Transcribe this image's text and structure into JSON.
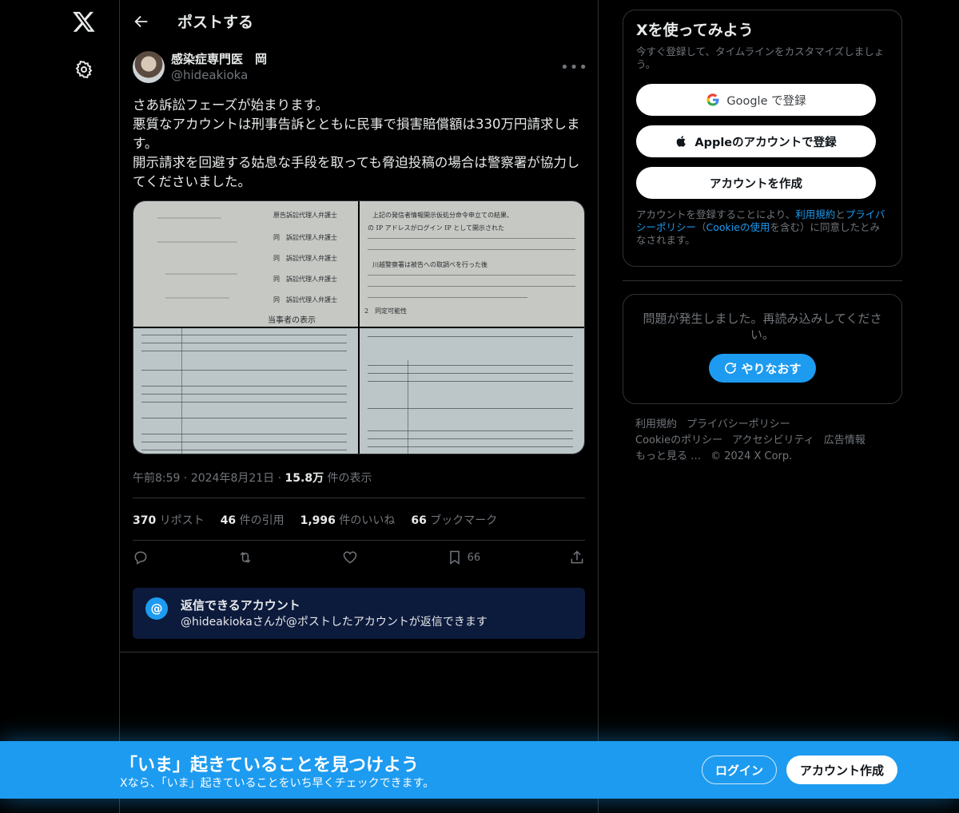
{
  "header": {
    "title": "ポストする"
  },
  "tweet": {
    "author_name": "感染症専門医　岡",
    "author_handle": "@hideakioka",
    "text": "さあ訴訟フェーズが始まります。\n悪質なアカウントは刑事告訴とともに民事で損害賠償額は330万円請求します。\n開示請求を回避する姑息な手段を取っても脅迫投稿の場合は警察署が協力してくださいました。",
    "time": "午前8:59",
    "date": "2024年8月21日",
    "views_count": "15.8万",
    "views_label": "件の表示",
    "stats": {
      "reposts_count": "370",
      "reposts_label": "リポスト",
      "quotes_count": "46",
      "quotes_label": "件の引用",
      "likes_count": "1,996",
      "likes_label": "件のいいね",
      "bookmarks_count": "66",
      "bookmarks_label": "ブックマーク"
    },
    "bookmark_action_count": "66",
    "media_text": {
      "doc1_footer": "当事者の表示",
      "doc1_lines": [
        "原告訴訟代理人弁護士",
        "同　訴訟代理人弁護士",
        "同　訴訟代理人弁護士",
        "同　訴訟代理人弁護士",
        "同　訴訟代理人弁護士"
      ],
      "doc2_lines": [
        "上記の発信者情報開示仮処分命令申立ての結果、",
        "の IP アドレスがログイン IP として開示された",
        "川越警察署は被告への取調べを行った後",
        "2　同定可能性"
      ]
    }
  },
  "reply_restriction": {
    "title": "返信できるアカウント",
    "subtitle": "@hideakiokaさんが@ポストしたアカウントが返信できます"
  },
  "signup": {
    "title": "Xを使ってみよう",
    "subtitle": "今すぐ登録して、タイムラインをカスタマイズしましょう。",
    "google_label": "Google で登録",
    "apple_label": "Appleのアカウントで登録",
    "create_label": "アカウントを作成",
    "legal_pre": "アカウントを登録することにより、",
    "legal_terms": "利用規約",
    "legal_and": "と",
    "legal_privacy": "プライバシーポリシー",
    "legal_mid": "（",
    "legal_cookie": "Cookieの使用",
    "legal_post": "を含む）に同意したとみなされます。"
  },
  "error": {
    "text": "問題が発生しました。再読み込みしてください。",
    "retry_label": "やりなおす"
  },
  "footer": {
    "links": [
      "利用規約",
      "プライバシーポリシー",
      "Cookieのポリシー",
      "アクセシビリティ",
      "広告情報",
      "もっと見る …"
    ],
    "copyright": "© 2024 X Corp."
  },
  "banner": {
    "title": "「いま」起きていることを見つけよう",
    "subtitle": "Xなら、「いま」起きていることをいち早くチェックできます。",
    "login_label": "ログイン",
    "create_label": "アカウント作成"
  },
  "colors": {
    "accent": "#1d9bf0",
    "background": "#000000",
    "border": "#2f3336",
    "muted": "#71767b"
  }
}
